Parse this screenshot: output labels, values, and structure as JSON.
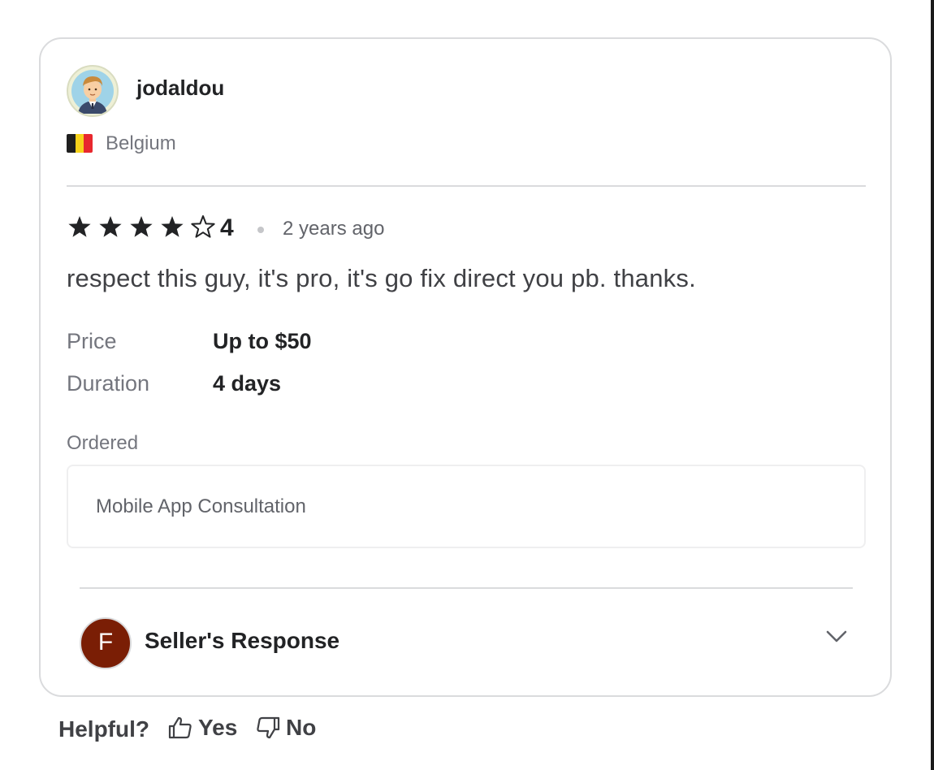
{
  "reviewer": {
    "username": "jodaldou",
    "avatar_icon": "cartoon-man-avatar",
    "country": "Belgium",
    "flag_colors": [
      "#1f1f1f",
      "#f7d21b",
      "#e8282e"
    ]
  },
  "rating": {
    "value": "4",
    "stars_filled": 4,
    "stars_total": 5,
    "time_ago": "2 years ago"
  },
  "review_text": "respect this guy, it's pro, it's go fix direct you pb. thanks.",
  "details": [
    {
      "label": "Price",
      "value": "Up to $50"
    },
    {
      "label": "Duration",
      "value": "4 days"
    }
  ],
  "ordered": {
    "label": "Ordered",
    "item": "Mobile App Consultation"
  },
  "seller_response": {
    "initial": "F",
    "title": "Seller's Response",
    "avatar_color": "#7a1e05"
  },
  "feedback": {
    "question": "Helpful?",
    "yes_label": "Yes",
    "no_label": "No"
  }
}
